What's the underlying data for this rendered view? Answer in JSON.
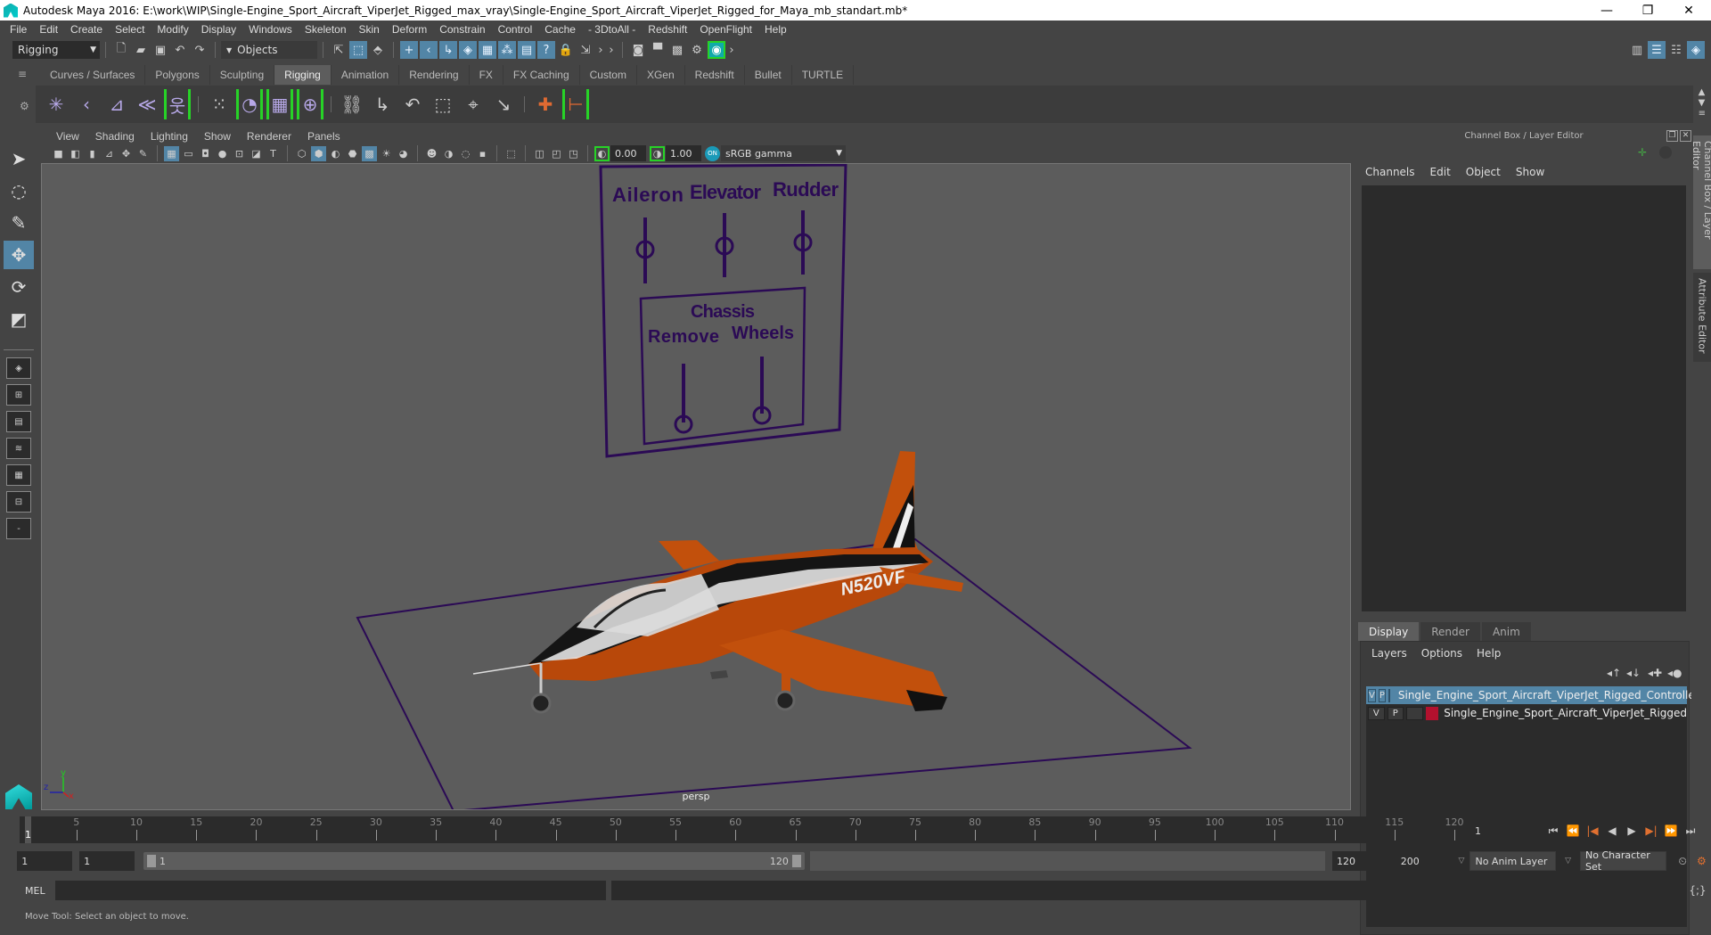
{
  "window": {
    "title": "Autodesk Maya 2016: E:\\work\\WIP\\Single-Engine_Sport_Aircraft_ViperJet_Rigged_max_vray\\Single-Engine_Sport_Aircraft_ViperJet_Rigged_for_Maya_mb_standart.mb*",
    "minimize": "—",
    "restore": "❐",
    "close": "✕"
  },
  "menubar": [
    "File",
    "Edit",
    "Create",
    "Select",
    "Modify",
    "Display",
    "Windows",
    "Skeleton",
    "Skin",
    "Deform",
    "Constrain",
    "Control",
    "Cache",
    "- 3DtoAll -",
    "Redshift",
    "OpenFlight",
    "Help"
  ],
  "statusline": {
    "menuset": "Rigging",
    "selection_mode": "Objects"
  },
  "shelf_tabs": [
    {
      "label": "Curves / Surfaces",
      "active": false
    },
    {
      "label": "Polygons",
      "active": false
    },
    {
      "label": "Sculpting",
      "active": false
    },
    {
      "label": "Rigging",
      "active": true
    },
    {
      "label": "Animation",
      "active": false
    },
    {
      "label": "Rendering",
      "active": false
    },
    {
      "label": "FX",
      "active": false
    },
    {
      "label": "FX Caching",
      "active": false
    },
    {
      "label": "Custom",
      "active": false
    },
    {
      "label": "XGen",
      "active": false
    },
    {
      "label": "Redshift",
      "active": false
    },
    {
      "label": "Bullet",
      "active": false
    },
    {
      "label": "TURTLE",
      "active": false
    }
  ],
  "shelf_icons": [
    "joint-tool",
    "ik-handle",
    "ik-spline",
    "bone-bind",
    "humanik-skeleton",
    "paint-skin-weights",
    "smooth-bind",
    "lattice",
    "cluster",
    "parent-constraint",
    "point-constraint",
    "orient-constraint",
    "scale-constraint",
    "aim-constraint",
    "pole-vector",
    "locator",
    "mirror-joint"
  ],
  "viewport": {
    "menu": [
      "View",
      "Shading",
      "Lighting",
      "Show",
      "Renderer",
      "Panels"
    ],
    "exposure": "0.00",
    "gamma": "1.00",
    "color_space": "sRGB gamma",
    "camera_label": "persp",
    "controller_labels": {
      "aileron": "Aileron",
      "elevator": "Elevator",
      "rudder": "Rudder",
      "chassis": "Chassis",
      "remove": "Remove",
      "wheels": "Wheels"
    },
    "aircraft_registration": "N520VF",
    "axis": {
      "x": "x",
      "y": "y",
      "z": "z"
    }
  },
  "channel_box": {
    "title": "Channel Box / Layer Editor",
    "menu": [
      "Channels",
      "Edit",
      "Object",
      "Show"
    ]
  },
  "layer_editor": {
    "tabs": [
      {
        "label": "Display",
        "active": true
      },
      {
        "label": "Render",
        "active": false
      },
      {
        "label": "Anim",
        "active": false
      }
    ],
    "menu": [
      "Layers",
      "Options",
      "Help"
    ],
    "layers": [
      {
        "v": "V",
        "p": "P",
        "color": "#2b0a55",
        "name": "Single_Engine_Sport_Aircraft_ViperJet_Rigged_Controlle",
        "selected": true
      },
      {
        "v": "V",
        "p": "P",
        "color": "#b3112e",
        "name": "Single_Engine_Sport_Aircraft_ViperJet_Rigged",
        "selected": false
      }
    ]
  },
  "side_tabs": [
    "Channel Box / Layer Editor",
    "Attribute Editor"
  ],
  "timeline": {
    "start": 1,
    "end": 120,
    "current_frame": "1",
    "current_frame_marker": "1",
    "tick_labels": [
      "5",
      "10",
      "15",
      "20",
      "25",
      "30",
      "35",
      "40",
      "45",
      "50",
      "55",
      "60",
      "65",
      "70",
      "75",
      "80",
      "85",
      "90",
      "95",
      "100",
      "105",
      "110",
      "115",
      "120"
    ]
  },
  "range": {
    "start_field": "1",
    "playback_start": "1",
    "slider_start": "1",
    "slider_end": "120",
    "playback_end": "120",
    "animation_end": "200",
    "anim_layer": "No Anim Layer",
    "character_set": "No Character Set"
  },
  "command_line": {
    "language": "MEL",
    "input": "",
    "result": ""
  },
  "help_line": "Move Tool: Select an object to move.",
  "colors": {
    "accent_blue": "#5285a6",
    "controller_purple": "#2b0a55",
    "aircraft_orange": "#c2500c",
    "panel_bg": "#444444",
    "viewport_bg": "#5c5c5c"
  }
}
